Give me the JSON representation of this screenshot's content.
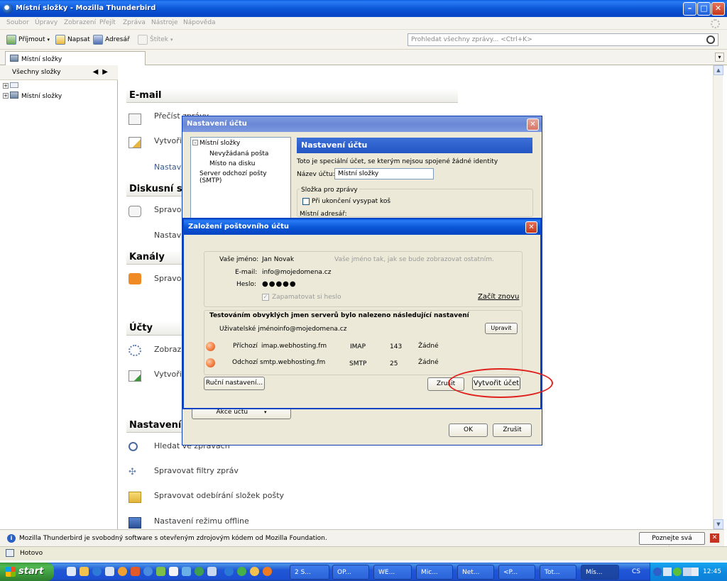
{
  "window": {
    "title": "Místní složky - Mozilla Thunderbird"
  },
  "menu": [
    "Soubor",
    "Úpravy",
    "Zobrazení",
    "Přejít",
    "Zpráva",
    "Nástroje",
    "Nápověda"
  ],
  "toolbar": {
    "get_mail": "Příjmout",
    "write": "Napsat",
    "address_book": "Adresář",
    "tag": "Štítek",
    "search_placeholder": "Prohledat všechny zprávy... <Ctrl+K>"
  },
  "tab": {
    "label": "Místní složky"
  },
  "folder_pane": {
    "header": "Všechny složky",
    "root": "Místní složky"
  },
  "content": {
    "sections": {
      "email": "E-mail",
      "discussion": "Diskusní sk",
      "feeds": "Kanály",
      "accounts": "Účty",
      "settings": "Nastavení"
    },
    "items": {
      "read": "Přečíst zprávy",
      "write": "Vytvořit",
      "setup": "Nastave",
      "manage_news": "Spravov",
      "setup_news": "Nastave",
      "manage_feeds": "Spravov",
      "show_accounts": "Zobrazit",
      "create_account": "Vytvořit",
      "search": "Hledat ve zprávách",
      "filters": "Spravovat filtry zpráv",
      "subscriptions": "Spravovat odebírání složek pošty",
      "offline": "Nastavení režimu offline"
    }
  },
  "account_settings": {
    "title": "Nastavení účtu",
    "tree": [
      "Místní složky",
      "Nevyžádaná pošta",
      "Místo na disku",
      "Server odchozí pošty (SMTP)"
    ],
    "panel_title": "Nastavení účtu",
    "description": "Toto je speciální účet, se kterým nejsou spojené žádné identity",
    "name_label": "Název účtu:",
    "name_value": "Místní složky",
    "folder_group": "Složka pro zprávy",
    "empty_trash": "Při ukončení vysypat koš",
    "local_dir": "Místní adresář:",
    "actions": "Akce účtu",
    "ok": "OK",
    "cancel": "Zrušit"
  },
  "new_account": {
    "title": "Založení poštovního účtu",
    "name_label": "Vaše jméno:",
    "name_value": "Jan Novak",
    "name_hint": "Vaše jméno tak, jak se bude zobrazovat ostatním.",
    "email_label": "E-mail:",
    "email_value": "info@mojedomena.cz",
    "password_label": "Heslo:",
    "password_value": "●●●●●",
    "remember": "Zapamatovat si heslo",
    "restart": "Začít znovu",
    "found_text": "Testováním obvyklých jmen serverů bylo nalezeno následující nastavení",
    "username_label": "Uživatelské jméno",
    "username_value": "info@mojedomena.cz",
    "edit": "Upravit",
    "incoming": {
      "label": "Příchozí",
      "host": "imap.webhosting.fm",
      "protocol": "IMAP",
      "port": "143",
      "security": "Žádné"
    },
    "outgoing": {
      "label": "Odchozí",
      "host": "smtp.webhosting.fm",
      "protocol": "SMTP",
      "port": "25",
      "security": "Žádné"
    },
    "manual": "Ruční nastavení...",
    "cancel": "Zrušit",
    "create": "Vytvořit účet",
    "highlight_color": "#e0201c"
  },
  "info_bar": {
    "text": "Mozilla Thunderbird je svobodný software s otevřeným zdrojovým kódem od Mozilla Foundation.",
    "button": "Poznejte svá práva..."
  },
  "status": {
    "text": "Hotovo"
  },
  "taskbar": {
    "start": "start",
    "tasks": [
      "2 S...",
      "OP...",
      "WE...",
      "Mic...",
      "Net...",
      "<P...",
      "Tot...",
      "Mís..."
    ],
    "lang": "CS",
    "clock": "12:45"
  }
}
